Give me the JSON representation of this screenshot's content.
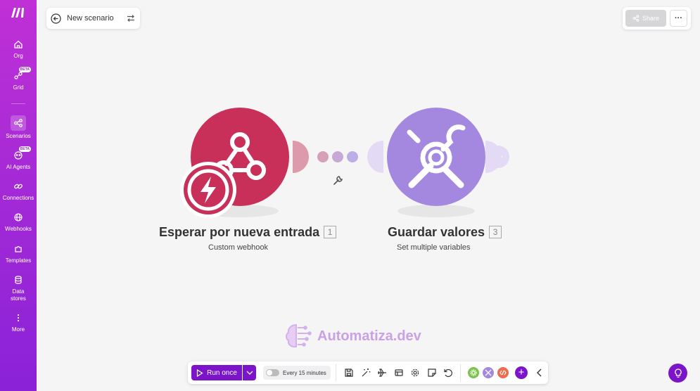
{
  "sidebar": {
    "items": [
      {
        "label": "Org",
        "icon": "home-icon"
      },
      {
        "label": "Grid",
        "icon": "grid-icon",
        "badge": "BETA"
      },
      {
        "label": "Scenarios",
        "icon": "scenarios-icon",
        "active": true
      },
      {
        "label": "AI Agents",
        "icon": "ai-agents-icon",
        "badge": "BETA"
      },
      {
        "label": "Connections",
        "icon": "link-icon"
      },
      {
        "label": "Webhooks",
        "icon": "globe-icon"
      },
      {
        "label": "Templates",
        "icon": "puzzle-icon"
      },
      {
        "label": "Data stores",
        "icon": "database-icon"
      },
      {
        "label": "More",
        "icon": "more-vertical-icon"
      }
    ]
  },
  "header": {
    "scenario_name": "New scenario",
    "share_label": "Share",
    "more_label": "···"
  },
  "modules": [
    {
      "title": "Esperar por nueva entrada",
      "number": "1",
      "subtitle": "Custom webhook",
      "color": "#c8305a"
    },
    {
      "title": "Guardar valores",
      "number": "3",
      "subtitle": "Set multiple variables",
      "color": "#a488e0"
    }
  ],
  "watermark": {
    "text": "Automatiza.dev"
  },
  "toolbar": {
    "run_label": "Run once",
    "schedule_label": "Every 15 minutes"
  },
  "colors": {
    "accent": "#7c14c9",
    "webhook": "#c8305a",
    "tools": "#a488e0"
  }
}
